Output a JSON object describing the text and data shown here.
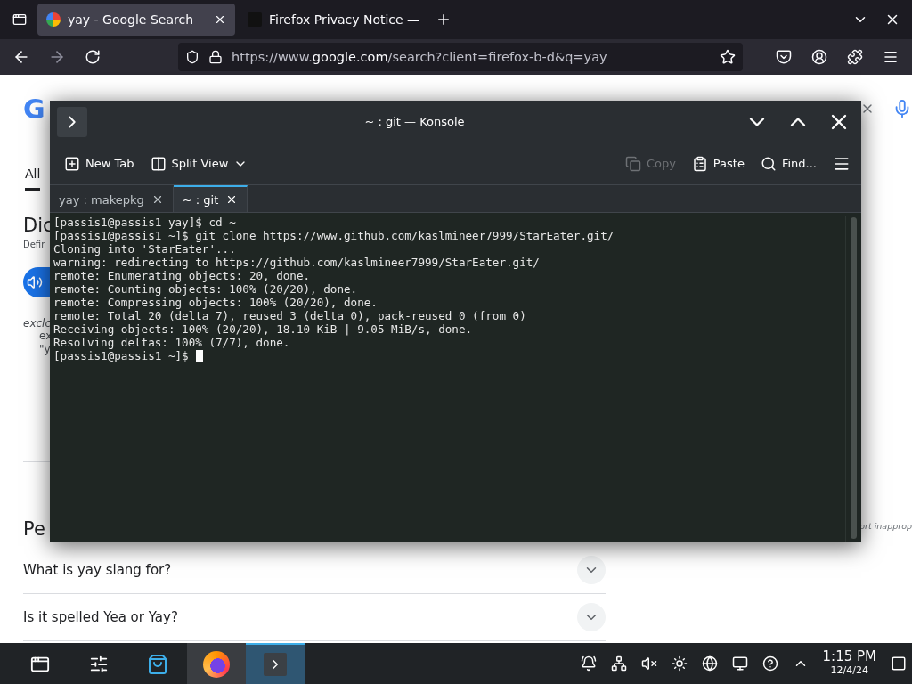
{
  "browser": {
    "tabs": [
      {
        "label": "yay - Google Search",
        "selected": true,
        "kind": "google"
      },
      {
        "label": "Firefox Privacy Notice —",
        "selected": false,
        "kind": "mozilla"
      }
    ],
    "url": {
      "start": "https://www.",
      "domain": "google.com",
      "rest": "/search?client=firefox-b-d&q=yay"
    }
  },
  "page": {
    "logo": "G",
    "tab": "All",
    "heading": "Dic",
    "subheading": "Defir",
    "italic_note": "exclc",
    "example_lines": [
      "ex",
      "\"y"
    ],
    "section_heading": "Pe",
    "report_link": "ort inapprop",
    "questions": [
      {
        "text": "What is yay slang for?",
        "expanded": false
      },
      {
        "text": "Is it spelled Yea or Yay?",
        "expanded": false
      }
    ]
  },
  "konsole": {
    "title": "~ : git — Konsole",
    "toolbar": [
      {
        "label": "New Tab",
        "kind": "new-tab",
        "disabled": false
      },
      {
        "label": "Split View",
        "kind": "split-view",
        "disabled": false
      },
      {
        "label": "Copy",
        "kind": "copy",
        "disabled": true
      },
      {
        "label": "Paste",
        "kind": "paste",
        "disabled": false
      },
      {
        "label": "Find...",
        "kind": "find",
        "disabled": false
      }
    ],
    "tabs": [
      {
        "label": "yay : makepkg",
        "selected": false
      },
      {
        "label": "~ : git",
        "selected": true
      }
    ],
    "lines": [
      "[passis1@passis1 yay]$ cd ~",
      "[passis1@passis1 ~]$ git clone https://www.github.com/kaslmineer7999/StarEater.git/",
      "Cloning into 'StarEater'...",
      "warning: redirecting to https://github.com/kaslmineer7999/StarEater.git/",
      "remote: Enumerating objects: 20, done.",
      "remote: Counting objects: 100% (20/20), done.",
      "remote: Compressing objects: 100% (20/20), done.",
      "remote: Total 20 (delta 7), reused 3 (delta 0), pack-reused 0 (from 0)",
      "Receiving objects: 100% (20/20), 18.10 KiB | 9.05 MiB/s, done.",
      "Resolving deltas: 100% (7/7), done."
    ],
    "prompt": "[passis1@passis1 ~]$"
  },
  "taskbar": {
    "apps": [
      {
        "kind": "launcher",
        "open": false,
        "selected": false
      },
      {
        "kind": "settings",
        "open": false,
        "selected": false
      },
      {
        "kind": "store",
        "open": false,
        "selected": false
      },
      {
        "kind": "firefox",
        "open": true,
        "selected": false
      },
      {
        "kind": "konsole",
        "open": true,
        "selected": true
      }
    ],
    "time": "1:15 PM",
    "date": "12/4/24"
  }
}
